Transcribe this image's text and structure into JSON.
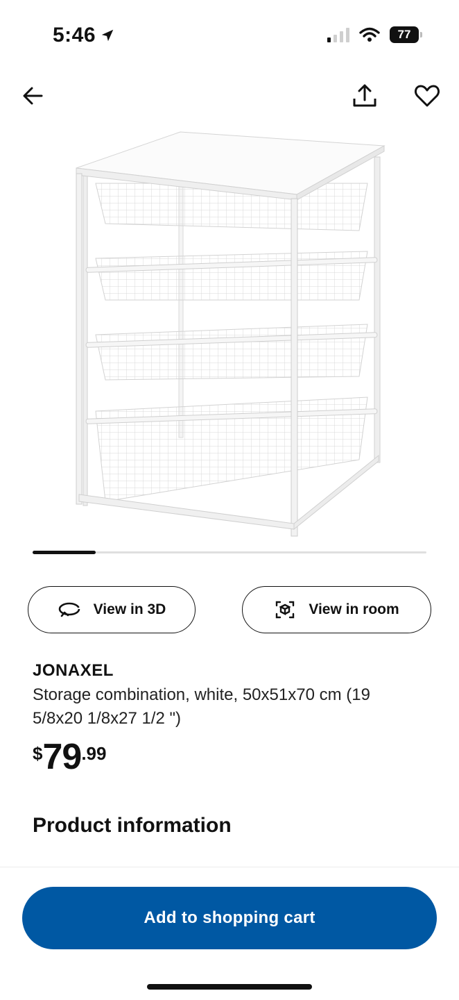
{
  "status_bar": {
    "time": "5:46",
    "battery": "77",
    "icons": [
      "location-arrow-icon",
      "signal-icon",
      "wifi-icon",
      "battery-icon"
    ]
  },
  "nav": {
    "icons": [
      "back-arrow-icon",
      "share-icon",
      "heart-icon"
    ]
  },
  "carousel": {
    "position": 0.16
  },
  "actions": {
    "view_3d": "View in 3D",
    "view_room": "View in room"
  },
  "product": {
    "name": "JONAXEL",
    "description": "Storage combination, white, 50x51x70 cm (19 5/8x20 1/8x27 1/2 \")",
    "price_currency": "$",
    "price_whole": "79",
    "price_decimal": ".99"
  },
  "sections": {
    "product_information": "Product information"
  },
  "cart": {
    "label": "Add to shopping cart"
  },
  "colors": {
    "accent": "#0058a3",
    "text": "#111111"
  }
}
